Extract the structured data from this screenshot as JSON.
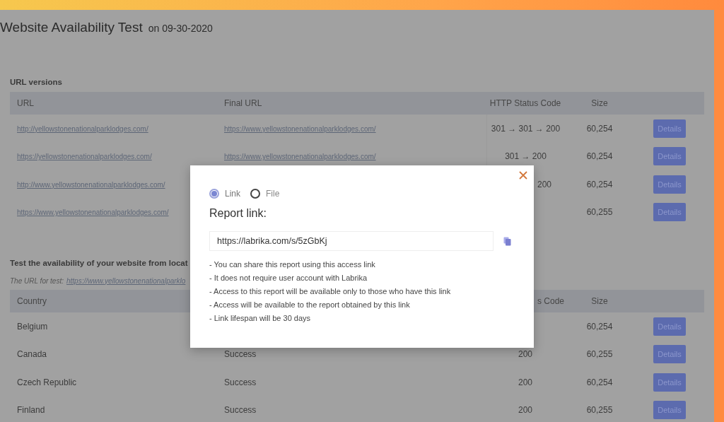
{
  "page": {
    "title": "Website Availability Test",
    "date": "on 09-30-2020"
  },
  "url_versions": {
    "heading": "URL versions",
    "columns": [
      "URL",
      "Final URL",
      "HTTP Status Code",
      "Size"
    ],
    "rows": [
      {
        "url": "http://yellowstonenationalparklodges.com/",
        "final_url": "https://www.yellowstonenationalparklodges.com/",
        "status": "301 → 301 → 200",
        "size": "60,254",
        "action": "Details"
      },
      {
        "url": "https://yellowstonenationalparklodges.com/",
        "final_url": "https://www.yellowstonenationalparklodges.com/",
        "status": "301 → 200",
        "size": "60,254",
        "action": "Details"
      },
      {
        "url": "http://www.yellowstonenationalparklodges.com/",
        "status": "200",
        "size": "60,254",
        "action": "Details"
      },
      {
        "url": "https://www.yellowstonenationalparklodges.com/",
        "size": "60,255",
        "action": "Details"
      }
    ]
  },
  "location_test": {
    "heading": "Test the availability of your website from locat",
    "note_label": "The URL for test:",
    "note_link": "https://www.yellowstonenationalparklo",
    "columns": [
      "Country",
      "s Code",
      "Size"
    ],
    "rows": [
      {
        "country": "Belgium",
        "size": "60,254",
        "action": "Details"
      },
      {
        "country": "Canada",
        "result": "Success",
        "status": "200",
        "size": "60,255",
        "action": "Details"
      },
      {
        "country": "Czech Republic",
        "result": "Success",
        "status": "200",
        "size": "60,254",
        "action": "Details"
      },
      {
        "country": "Finland",
        "result": "Success",
        "status": "200",
        "size": "60,255",
        "action": "Details"
      }
    ]
  },
  "share_dialog": {
    "options": [
      {
        "label": "Link",
        "selected": true
      },
      {
        "label": "File",
        "selected": false
      }
    ],
    "heading": "Report link:",
    "link_value": "https://labrika.com/s/5zGbKj",
    "notes": [
      "- You can share this report using this access link",
      "- It does not require user account with Labrika",
      "- Access to this report will be available only to those who have this link",
      "- Access will be available to the report obtained by this link",
      "- Link lifespan will be 30 days"
    ]
  }
}
